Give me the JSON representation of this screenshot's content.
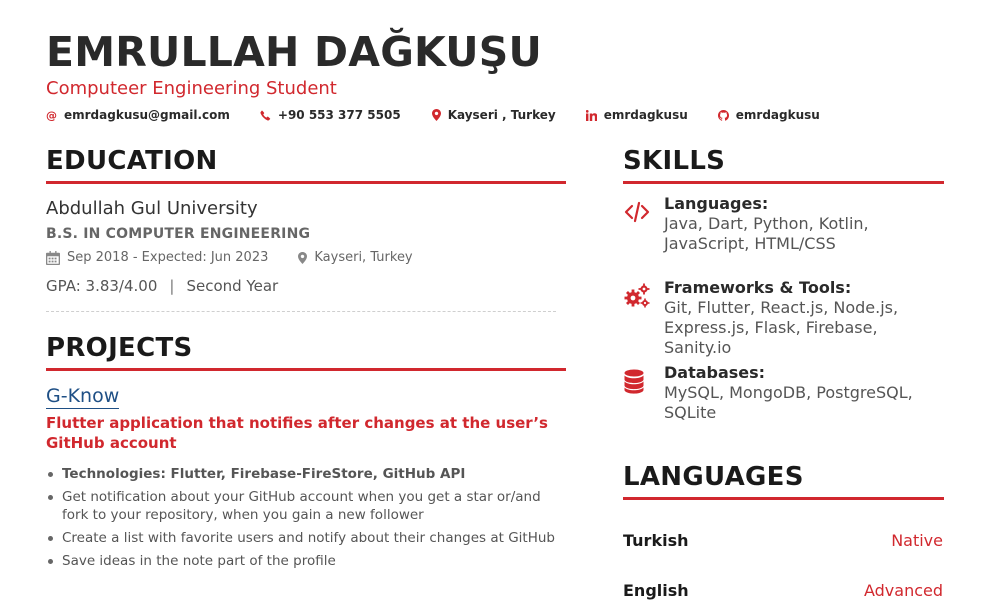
{
  "header": {
    "name": "EMRULLAH DAĞKUŞU",
    "title": "Computeer Engineering Student",
    "contacts": {
      "email": "emrdagkusu@gmail.com",
      "phone": "+90 553 377 5505",
      "location": "Kayseri , Turkey",
      "linkedin": "emrdagkusu",
      "github": "emrdagkusu"
    }
  },
  "education": {
    "heading": "EDUCATION",
    "school": "Abdullah Gul University",
    "degree": "B.S. IN COMPUTER ENGINEERING",
    "dates": "Sep 2018 - Expected: Jun 2023",
    "location": "Kayseri, Turkey",
    "gpa": "GPA: 3.83/4.00",
    "separator": "|",
    "year": "Second Year"
  },
  "projects": {
    "heading": "PROJECTS",
    "items": [
      {
        "name": "G-Know",
        "description": "Flutter application that notifies after changes at the user’s GitHub account",
        "bullets": [
          "Technologies: Flutter, Firebase-FireStore, GitHub API",
          "Get notification about your GitHub account when you get a star or/and fork to your repository, when you gain a new follower",
          "Create a list with favorite users and notify about their changes at GitHub",
          "Save ideas in the note part of the profile"
        ]
      }
    ]
  },
  "skills": {
    "heading": "SKILLS",
    "items": [
      {
        "label": "Languages:",
        "value": "Java, Dart, Python, Kotlin, JavaScript, HTML/CSS",
        "icon": "code-icon"
      },
      {
        "label": "Frameworks & Tools:",
        "value": "Git, Flutter, React.js, Node.js, Express.js, Flask, Firebase, Sanity.io",
        "icon": "cogs-icon"
      },
      {
        "label": "Databases:",
        "value": "MySQL, MongoDB, PostgreSQL, SQLite",
        "icon": "database-icon"
      }
    ]
  },
  "languages": {
    "heading": "LANGUAGES",
    "items": [
      {
        "name": "Turkish",
        "level": "Native"
      },
      {
        "name": "English",
        "level": "Advanced"
      }
    ]
  },
  "colors": {
    "accent": "#d1282e",
    "link": "#1e4f85",
    "text": "#2a2a2a",
    "muted": "#666666"
  }
}
